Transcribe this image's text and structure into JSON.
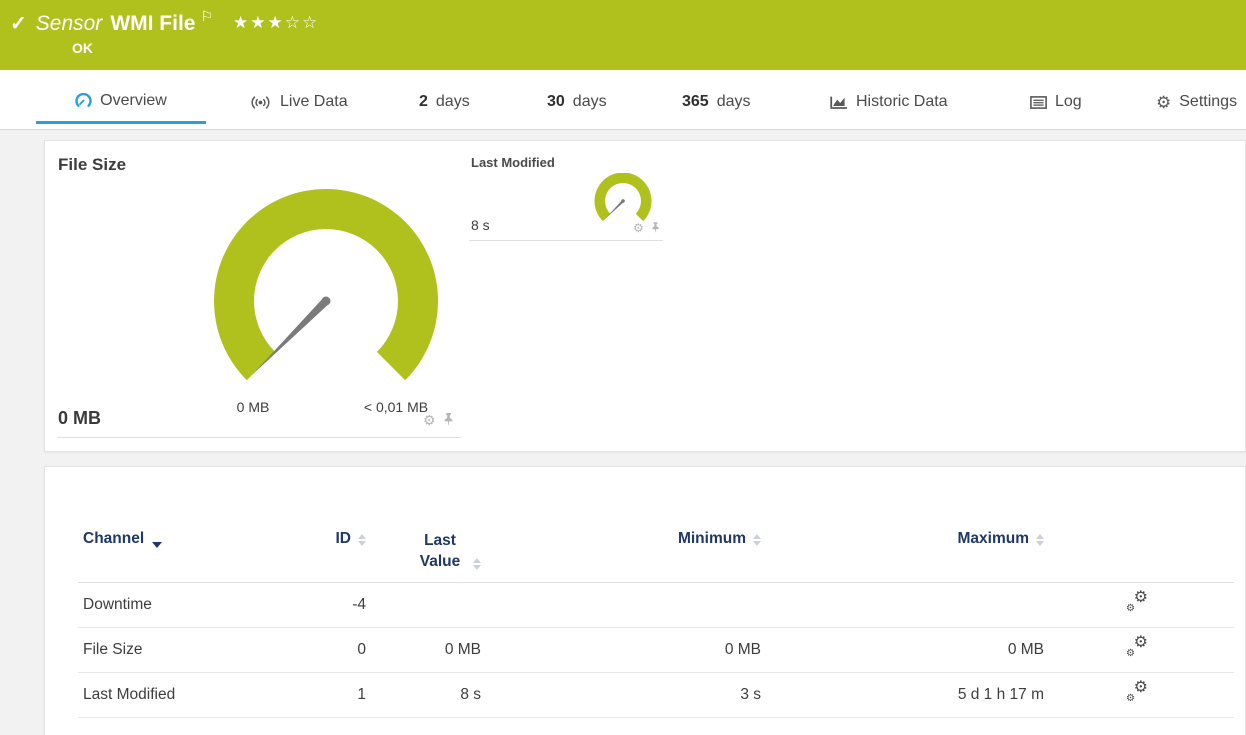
{
  "header": {
    "sensor_kind": "Sensor",
    "sensor_name": "WMI File",
    "status": "OK",
    "rating_filled": "★★★",
    "rating_empty": "☆☆"
  },
  "tabs": {
    "overview": "Overview",
    "live_data": "Live Data",
    "days2_num": "2",
    "days2_label": "days",
    "days30_num": "30",
    "days30_label": "days",
    "days365_num": "365",
    "days365_label": "days",
    "historic": "Historic Data",
    "log": "Log",
    "settings": "Settings"
  },
  "gauges": {
    "file_size": {
      "title": "File Size",
      "current_value": "0 MB",
      "scale_min": "0 MB",
      "scale_max": "< 0,01 MB"
    },
    "last_modified": {
      "title": "Last Modified",
      "current_value": "8 s"
    }
  },
  "table": {
    "headers": {
      "channel": "Channel",
      "id": "ID",
      "last_value": "Last Value",
      "minimum": "Minimum",
      "maximum": "Maximum"
    },
    "rows": [
      {
        "channel": "Downtime",
        "id": "-4",
        "last_value": "",
        "minimum": "",
        "maximum": ""
      },
      {
        "channel": "File Size",
        "id": "0",
        "last_value": "0 MB",
        "minimum": "0 MB",
        "maximum": "0 MB"
      },
      {
        "channel": "Last Modified",
        "id": "1",
        "last_value": "8 s",
        "minimum": "3 s",
        "maximum": "5 d 1 h 17 m"
      }
    ]
  },
  "icons": {
    "check": "✓",
    "flag": "⚐",
    "gear": "⚙"
  },
  "colors": {
    "status_green": "#b0c11e",
    "accent_blue": "#2b9fd9",
    "header_navy": "#1f3864",
    "needle_gray": "#7b7b7b"
  }
}
